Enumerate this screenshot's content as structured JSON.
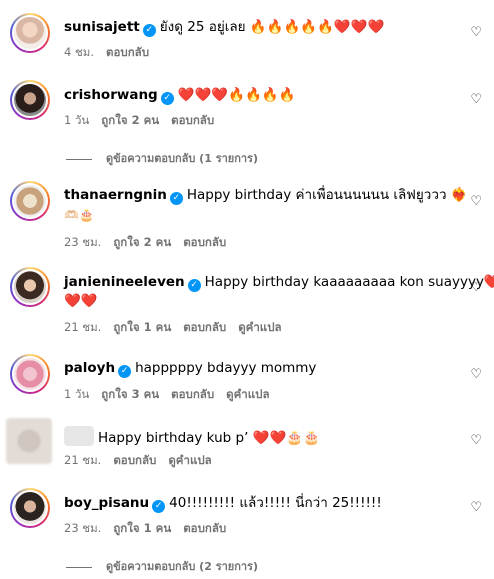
{
  "comments": [
    {
      "username": "sunisajett",
      "text": "ยังดู 25 อยู่เลย 🔥🔥🔥🔥🔥❤️❤️❤️",
      "time": "4 ชม.",
      "reply": "ตอบกลับ"
    },
    {
      "username": "crishorwang",
      "text": "❤️❤️❤️🔥🔥🔥🔥",
      "time": "1 วัน",
      "likes": "ถูกใจ 2 คน",
      "reply": "ตอบกลับ",
      "view_replies": "ดูข้อความตอบกลับ (1 รายการ)"
    },
    {
      "username": "thanaerngnin",
      "text": "Happy birthday ค่าเพื่อนนนนนน เลิฟยูววว ❤️‍🔥",
      "text2": "🫶🏻🎂",
      "time": "23 ชม.",
      "likes": "ถูกใจ 2 คน",
      "reply": "ตอบกลับ"
    },
    {
      "username": "janienineeleven",
      "text": "Happy birthday kaaaaaaaaa kon suayyyy❤️",
      "text2": "❤️❤️",
      "time": "21 ชม.",
      "likes": "ถูกใจ 1 คน",
      "reply": "ตอบกลับ",
      "translate": "ดูคำแปล"
    },
    {
      "username": "paloyh",
      "text": "happpppy bdayyy mommy",
      "time": "1 วัน",
      "likes": "ถูกใจ 3 คน",
      "reply": "ตอบกลับ",
      "translate": "ดูคำแปล"
    },
    {
      "username": "",
      "text": "Happy birthday kub p’ ❤️❤️🎂🎂",
      "time": "21 ชม.",
      "reply": "ตอบกลับ",
      "translate": "ดูคำแปล"
    },
    {
      "username": "boy_pisanu",
      "text": "40!!!!!!!!! แล้ว!!!!! นี่กว่า 25!!!!!!",
      "time": "23 ชม.",
      "likes": "ถูกใจ 1 คน",
      "reply": "ตอบกลับ",
      "view_replies": "ดูข้อความตอบกลับ (2 รายการ)"
    }
  ],
  "icons": {
    "verified": "verified-badge-icon",
    "like": "heart-outline-icon"
  },
  "colors": {
    "verified": "#0095f6",
    "meta_text": "#737373"
  }
}
